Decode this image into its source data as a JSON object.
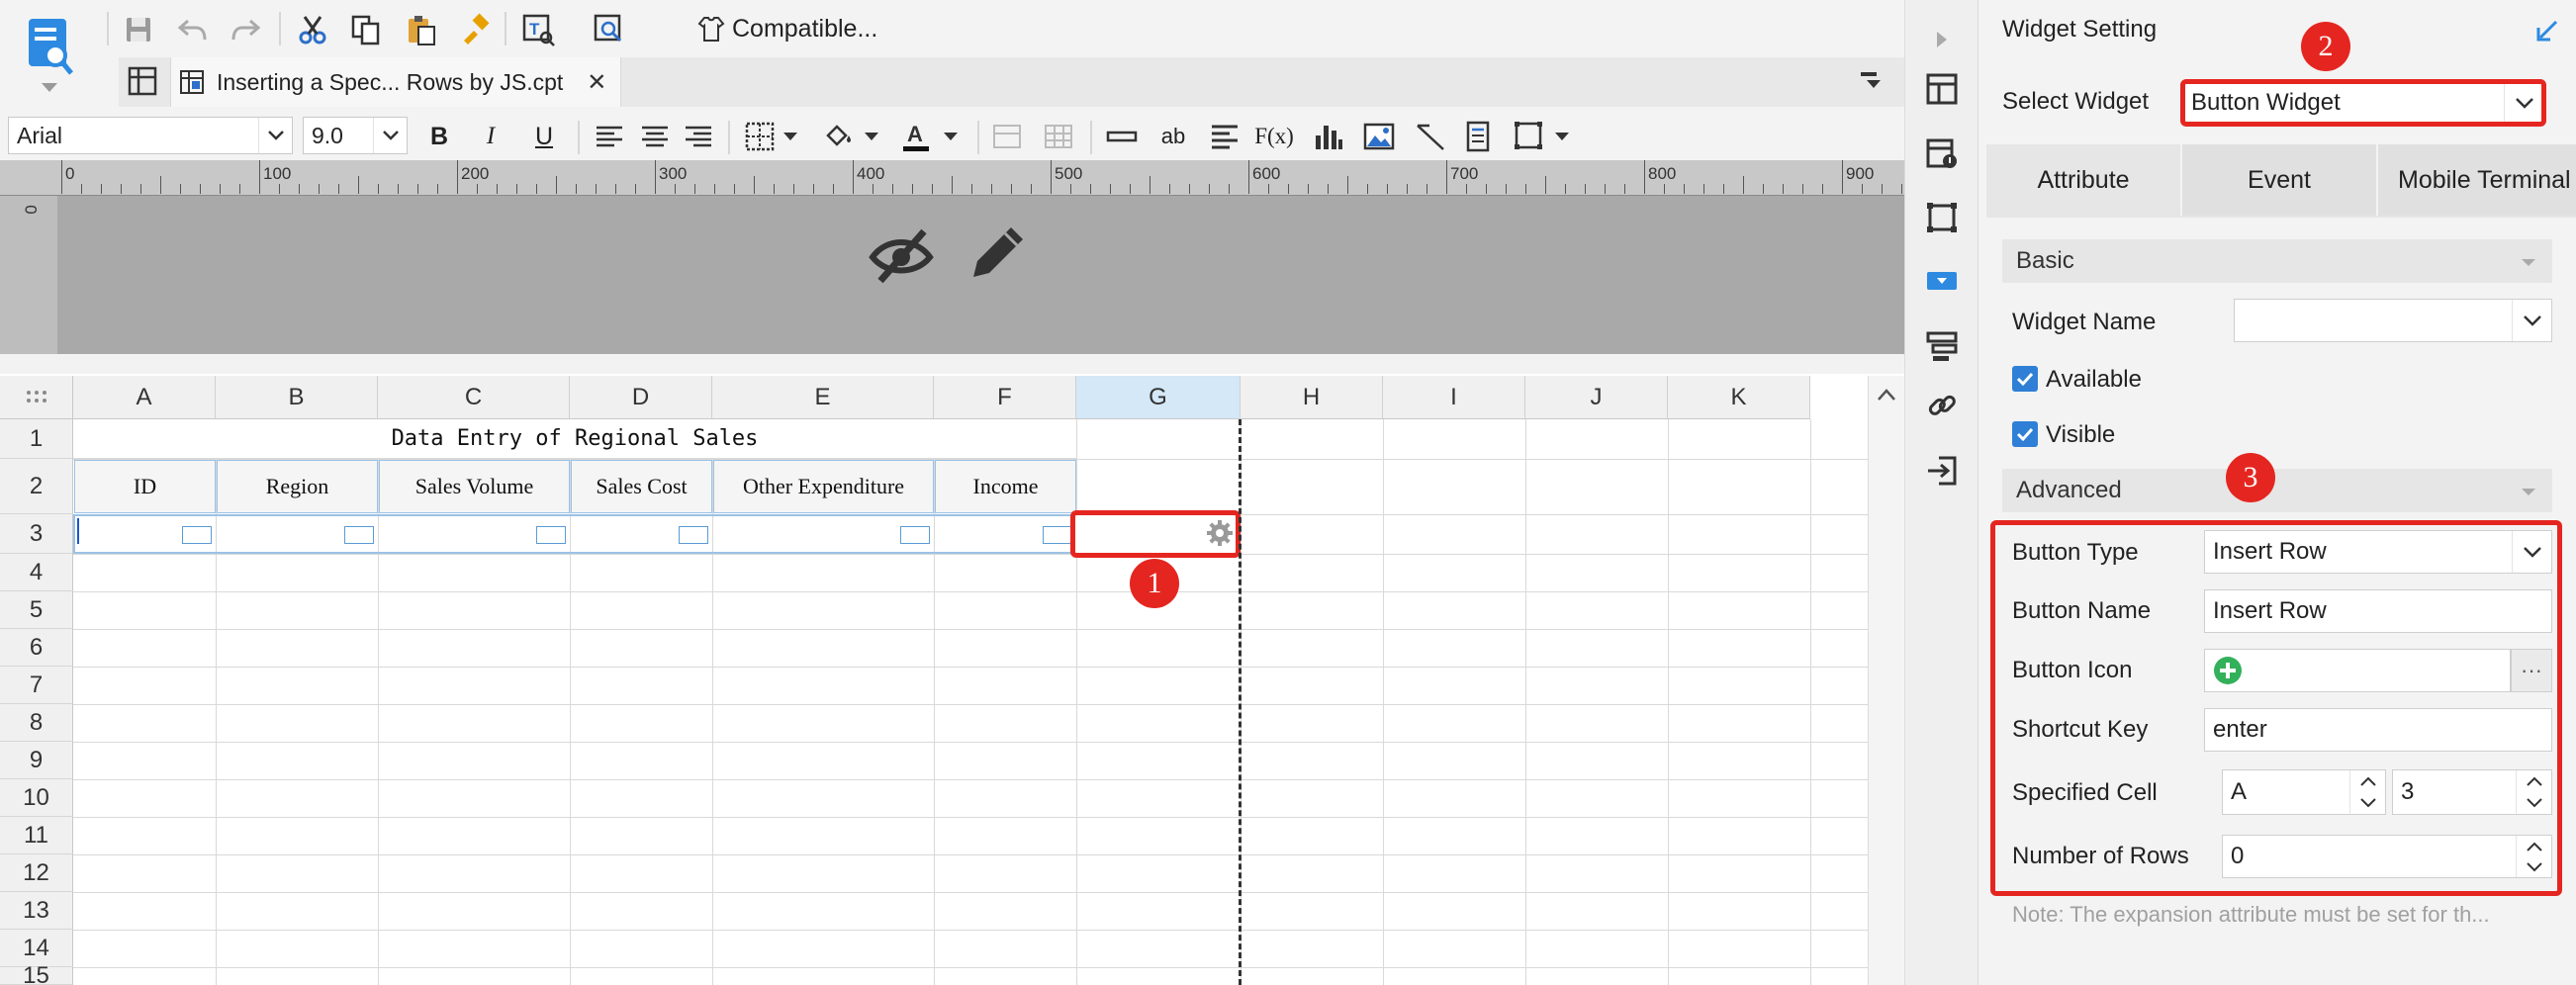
{
  "toolbar": {
    "compatible_label": "Compatible...",
    "tab_title": "Inserting a Spec... Rows by JS.cpt",
    "tab_close": "✕",
    "font_name": "Arial",
    "font_size": "9.0",
    "bold": "B",
    "italic": "I",
    "underline": "U",
    "label_ab": "ab",
    "label_fx": "F(x)"
  },
  "ruler": {
    "marks": [
      "0",
      "100",
      "200",
      "300",
      "400",
      "500",
      "600",
      "700",
      "800",
      "900"
    ],
    "vertical_mark": "0"
  },
  "sheet": {
    "columns": [
      "A",
      "B",
      "C",
      "D",
      "E",
      "F",
      "G",
      "H",
      "I",
      "J",
      "K"
    ],
    "rows": [
      "1",
      "2",
      "3",
      "4",
      "5",
      "6",
      "7",
      "8",
      "9",
      "10",
      "11",
      "12",
      "13",
      "14",
      "15"
    ],
    "title": "Data Entry of Regional Sales",
    "headers": [
      "ID",
      "Region",
      "Sales Volume",
      "Sales Cost",
      "Other Expenditure",
      "Income"
    ],
    "selected_column": "G"
  },
  "callouts": {
    "one": "1",
    "two": "2",
    "three": "3"
  },
  "panel": {
    "title": "Widget Setting",
    "select_widget_label": "Select Widget",
    "select_widget_value": "Button Widget",
    "tabs": [
      "Attribute",
      "Event",
      "Mobile Terminal"
    ],
    "basic_label": "Basic",
    "widget_name_label": "Widget Name",
    "widget_name_value": "",
    "available_label": "Available",
    "visible_label": "Visible",
    "advanced_label": "Advanced",
    "button_type_label": "Button Type",
    "button_type_value": "Insert Row",
    "button_name_label": "Button Name",
    "button_name_value": "Insert Row",
    "button_icon_label": "Button Icon",
    "button_icon_more": "···",
    "shortcut_key_label": "Shortcut Key",
    "shortcut_key_value": "enter",
    "specified_cell_label": "Specified Cell",
    "specified_cell_col": "A",
    "specified_cell_row": "3",
    "number_of_rows_label": "Number of Rows",
    "number_of_rows_value": "0",
    "note": "Note: The expansion attribute must be set for th..."
  },
  "colors": {
    "accent_red": "#e52620",
    "selection_blue": "#5b9bd5",
    "checkbox_blue": "#2f7fd6"
  }
}
